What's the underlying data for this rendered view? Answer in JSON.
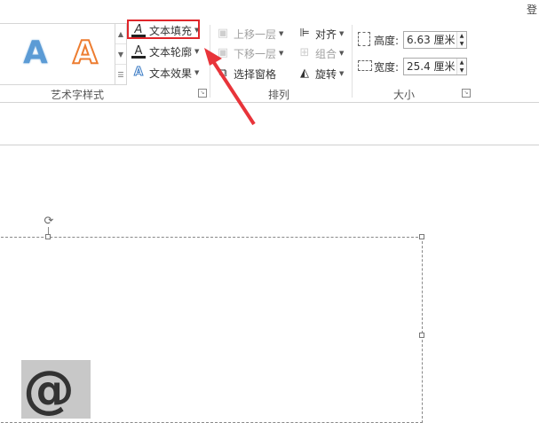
{
  "header": {
    "login_partial": "登"
  },
  "wordart_styles": {
    "gallery": [
      {
        "glyph": "A",
        "style": "blue-fill-icon"
      },
      {
        "glyph": "A",
        "style": "orange-outline-icon"
      }
    ],
    "text_fill": "文本填充",
    "text_outline": "文本轮廓",
    "text_effects": "文本效果",
    "group_label": "艺术字样式"
  },
  "arrange": {
    "bring_forward": "上移一层",
    "send_backward": "下移一层",
    "selection_pane": "选择窗格",
    "align": "对齐",
    "group": "组合",
    "rotate": "旋转",
    "group_label": "排列"
  },
  "size": {
    "height_label": "高度:",
    "height_value": "6.63 厘米",
    "width_label": "宽度:",
    "width_value": "25.4 厘米",
    "group_label": "大小"
  },
  "canvas": {
    "symbol": "@"
  },
  "colors": {
    "highlight": "#e0262b",
    "arrow": "#e8343a",
    "wordart_blue": "#5b9bd5",
    "wordart_orange": "#ed7d31"
  }
}
